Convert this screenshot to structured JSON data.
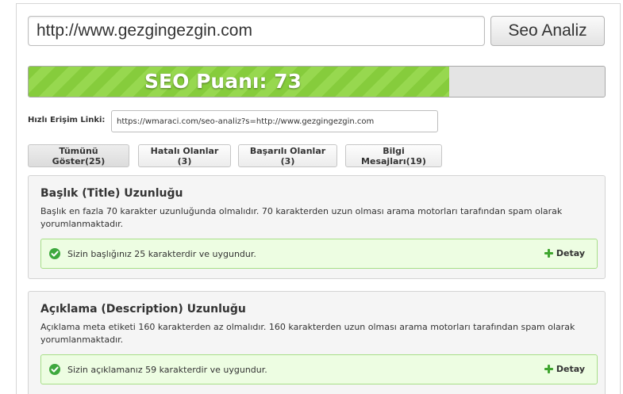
{
  "search": {
    "url_value": "http://www.gezgingezgin.com",
    "button_label": "Seo Analiz"
  },
  "score": {
    "label": "SEO Puanı: 73",
    "value": 73,
    "max": 100
  },
  "quick_access": {
    "label": "Hızlı Erişim Linki:",
    "link": "https://wmaraci.com/seo-analiz?s=http://www.gezgingezgin.com"
  },
  "filters": [
    {
      "label": "Tümünü Göster(25)"
    },
    {
      "label": "Hatalı Olanlar (3)"
    },
    {
      "label": "Başarılı Olanlar (3)"
    },
    {
      "label": "Bilgi Mesajları(19)"
    }
  ],
  "cards": [
    {
      "title": "Başlık (Title) Uzunluğu",
      "description": "Başlık en fazla 70 karakter uzunluğunda olmalıdır. 70 karakterden uzun olması arama motorları tarafından spam olarak yorumlanmaktadır.",
      "result": "Sizin başlığınız 25 karakterdir ve uygundur.",
      "detail_label": "Detay"
    },
    {
      "title": "Açıklama (Description) Uzunluğu",
      "description": "Açıklama meta etiketi 160 karakterden az olmalıdır. 160 karakterden uzun olması arama motorları tarafından spam olarak yorumlanmaktadır.",
      "result": "Sizin açıklamanız 59 karakterdir ve uygundur.",
      "detail_label": "Detay"
    }
  ],
  "colors": {
    "progress_fill": "#8bd042",
    "success_border": "#a7de87",
    "success_bg": "#edfde2",
    "check": "#3ea83e"
  }
}
